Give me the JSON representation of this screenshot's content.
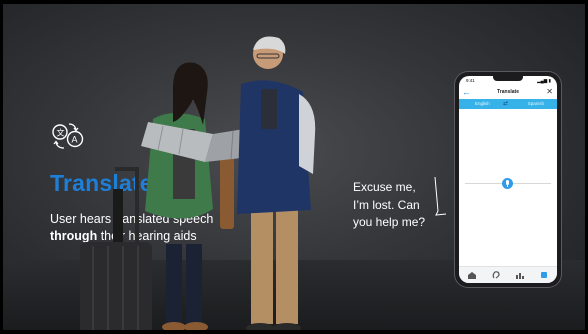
{
  "feature": {
    "title": "Translate",
    "description_prefix": "User hears translated speech",
    "description_bold": "through",
    "description_suffix": "their hearing aids",
    "icon": "translate-icon"
  },
  "speech": {
    "lines": [
      "Excuse me,",
      "I’m lost. Can",
      "you help me?"
    ]
  },
  "phone": {
    "status_time": "9:41",
    "status_icons": "▂▄▆ ▮",
    "screen_title": "Translate",
    "language_from": "English",
    "language_to": "Spanish",
    "swap_icon": "swap-arrows-icon",
    "back_icon": "back-arrow-icon",
    "close_icon": "close-icon",
    "mic_icon": "microphone-icon",
    "accent_color": "#36b2e8",
    "nav_icons": [
      "home-icon",
      "hearing-icon",
      "stats-icon",
      "settings-icon"
    ]
  },
  "colors": {
    "title": "#1e7fd8",
    "background": "#34363a"
  }
}
